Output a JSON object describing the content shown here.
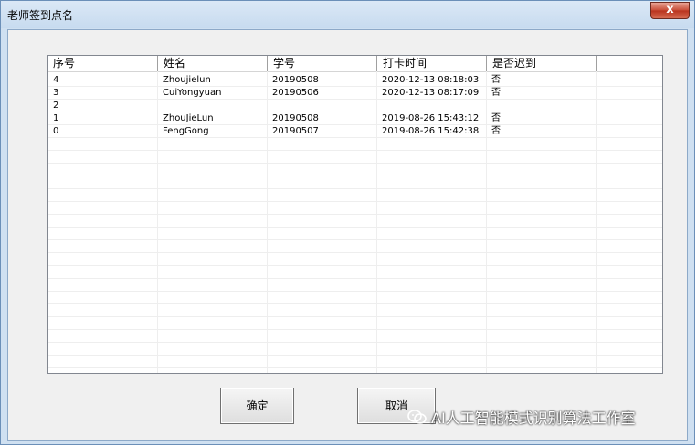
{
  "window": {
    "title": "老师签到点名",
    "close_label": "x"
  },
  "table": {
    "columns": [
      "序号",
      "姓名",
      "学号",
      "打卡时间",
      "是否迟到"
    ],
    "rows": [
      [
        "4",
        "Zhoujielun",
        "20190508",
        "2020-12-13 08:18:03",
        "否"
      ],
      [
        "3",
        "CuiYongyuan",
        "20190506",
        "2020-12-13 08:17:09",
        "否"
      ],
      [
        "2",
        "",
        "",
        "",
        ""
      ],
      [
        "1",
        "ZhouJieLun",
        "20190508",
        "2019-08-26 15:43:12",
        "否"
      ],
      [
        "0",
        "FengGong",
        "20190507",
        "2019-08-26 15:42:38",
        "否"
      ]
    ]
  },
  "buttons": {
    "ok_label": "确定",
    "cancel_label": "取消"
  },
  "watermark": {
    "text": "AI人工智能模式识别算法工作室",
    "icon": "wechat-icon"
  },
  "colors": {
    "close_button": "#c74a34",
    "title_bar": "#cfe0f1",
    "dialog_bg": "#f0f0f0"
  }
}
